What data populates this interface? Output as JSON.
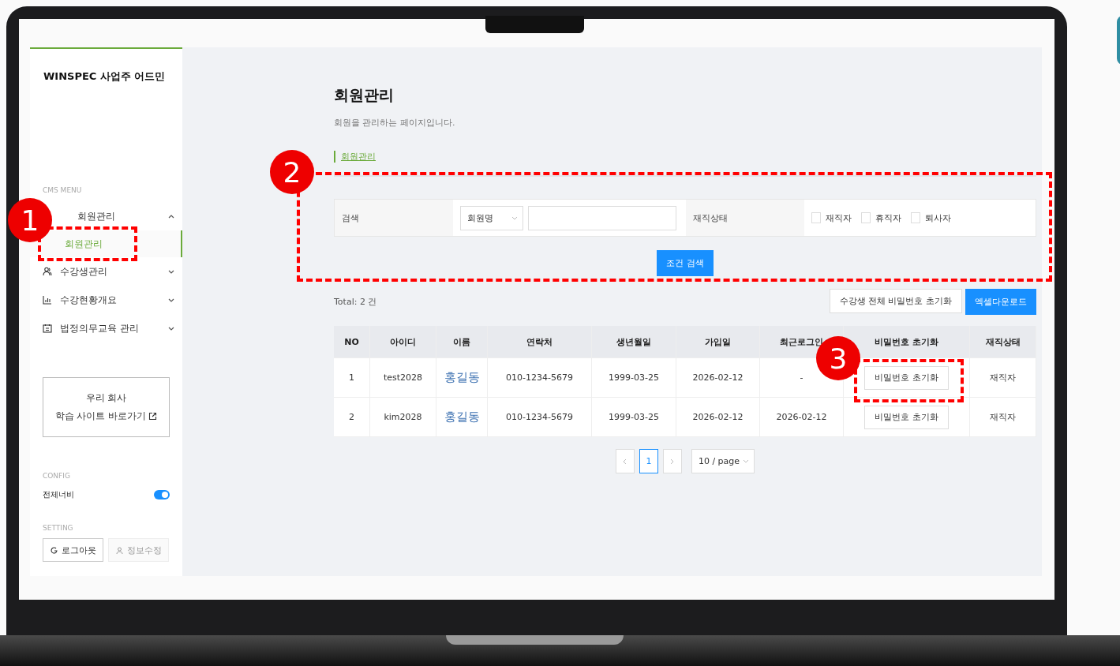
{
  "sidebar": {
    "title": "WINSPEC 사업주 어드민",
    "menu_label": "CMS MENU",
    "menu": [
      {
        "label": "회원관리",
        "expanded": true,
        "children": [
          {
            "label": "회원관리",
            "selected": true
          }
        ]
      },
      {
        "label": "수강생관리",
        "kind": "people",
        "expanded": false
      },
      {
        "label": "수강현황개요",
        "kind": "chart",
        "expanded": false
      },
      {
        "label": "법정의무교육 관리",
        "kind": "calendar",
        "expanded": false
      }
    ],
    "shortcut": [
      "우리 회사",
      "학습 사이트 바로가기"
    ],
    "config_label": "CONFIG",
    "toggle": {
      "label": "전체너비",
      "on": true
    },
    "setting_label": "SETTING",
    "setting_buttons": [
      {
        "label": "로그아웃",
        "kind": "logout",
        "disabled": false
      },
      {
        "label": "정보수정",
        "kind": "profile",
        "disabled": true
      }
    ]
  },
  "main": {
    "title": "회원관리",
    "subtitle": "회원을 관리하는 페이지입니다.",
    "tabs": [
      {
        "label": "회원관리",
        "selected": true
      }
    ],
    "search": {
      "label": "검색",
      "select": "회원명",
      "status_label": "재직상태",
      "status_options": [
        {
          "label": "재직자",
          "checked": false
        },
        {
          "label": "휴직자",
          "checked": false
        },
        {
          "label": "퇴사자",
          "checked": false
        }
      ],
      "button": "조건 검색"
    },
    "total": "Total: 2 건",
    "actions": [
      "수강생 전체 비밀번호 초기화",
      "엑셀다운로드"
    ],
    "table": {
      "columns": [
        "NO",
        "아이디",
        "이름",
        "연락처",
        "생년월일",
        "가입일",
        "최근로그인",
        "비밀번호 초기화",
        "재직상태"
      ],
      "rows": [
        {
          "cells": [
            "1",
            "test2028",
            "홍길동",
            "010-1234-5679",
            "1999-03-25",
            "2026-02-12",
            "-"
          ],
          "reset": "비밀번호 초기화",
          "status": "재직자"
        },
        {
          "cells": [
            "2",
            "kim2028",
            "홍길동",
            "010-1234-5679",
            "1999-03-25",
            "2026-02-12",
            "2026-02-12"
          ],
          "reset": "비밀번호 초기화",
          "status": "재직자"
        }
      ]
    },
    "pagination": {
      "pages": [
        {
          "label": "1",
          "selected": true
        }
      ],
      "page_size": "10 / page"
    }
  },
  "annotations": [
    {
      "number": "1"
    },
    {
      "number": "2"
    },
    {
      "number": "3"
    }
  ]
}
